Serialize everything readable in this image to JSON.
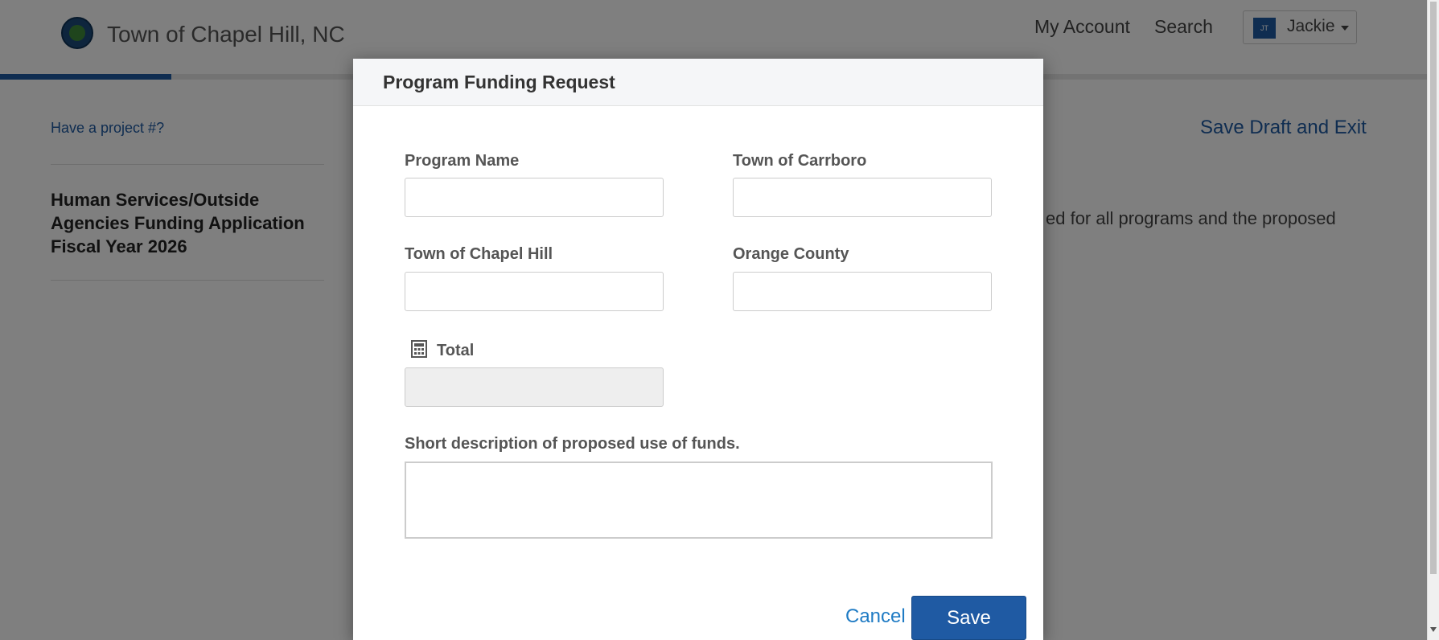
{
  "header": {
    "site_title": "Town of Chapel Hill, NC",
    "nav": {
      "my_account": "My Account",
      "search": "Search"
    },
    "user": {
      "initials": "JT",
      "name": "Jackie"
    }
  },
  "progress_fraction": 0.12,
  "sidebar": {
    "project_link": "Have a project #?",
    "title": "Human Services/Outside Agencies Funding Application Fiscal Year 2026"
  },
  "main": {
    "save_draft": "Save Draft and Exit",
    "partial_text": "ed for all programs and the proposed"
  },
  "modal": {
    "title": "Program Funding Request",
    "fields": {
      "program_name": {
        "label": "Program Name",
        "value": ""
      },
      "carrboro": {
        "label": "Town of Carrboro",
        "value": ""
      },
      "chapel_hill": {
        "label": "Town of Chapel Hill",
        "value": ""
      },
      "orange_county": {
        "label": "Orange County",
        "value": ""
      },
      "total": {
        "label": "Total",
        "value": ""
      },
      "description": {
        "label": "Short description of proposed use of funds.",
        "value": ""
      }
    },
    "cancel_label": "Cancel",
    "save_label": "Save"
  },
  "icons": {
    "logo": "town-seal-icon",
    "total": "calculator-icon",
    "user_menu": "caret-down-icon"
  },
  "colors": {
    "brand_blue": "#1f5aa3",
    "link_blue": "#1f7bc4",
    "overlay": "rgba(0,0,0,0.5)"
  }
}
